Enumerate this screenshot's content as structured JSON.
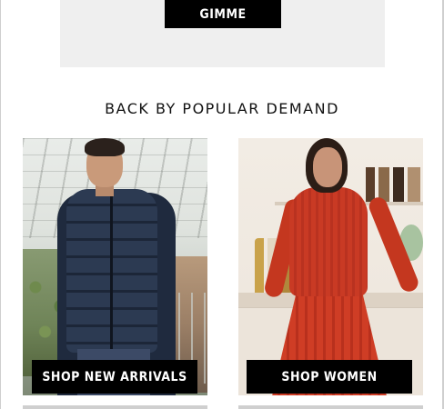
{
  "promo": {
    "button_label": "GIMME"
  },
  "section": {
    "heading": "BACK BY POPULAR DEMAND"
  },
  "cards": [
    {
      "cta_label": "SHOP NEW ARRIVALS"
    },
    {
      "cta_label": "SHOP WOMEN"
    }
  ],
  "colors": {
    "button_bg": "#000000",
    "button_text": "#ffffff",
    "promo_bg": "#efefef"
  }
}
